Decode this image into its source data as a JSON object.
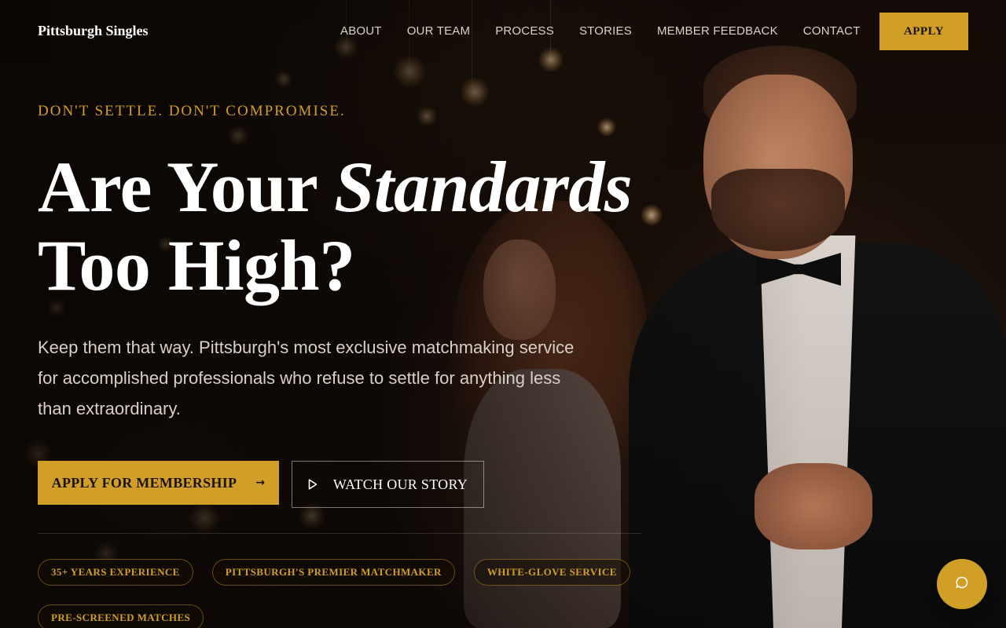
{
  "brand": {
    "name": "Pittsburgh Singles",
    "accent_color": "#d19f27"
  },
  "nav": {
    "items": [
      {
        "label": "ABOUT"
      },
      {
        "label": "OUR TEAM"
      },
      {
        "label": "PROCESS"
      },
      {
        "label": "STORIES"
      },
      {
        "label": "MEMBER FEEDBACK"
      },
      {
        "label": "CONTACT"
      }
    ],
    "apply_label": "APPLY"
  },
  "hero": {
    "eyebrow": "DON'T SETTLE. DON'T COMPROMISE.",
    "headline_part1": "Are Your ",
    "headline_emphasis": "Standards",
    "headline_part2": "Too High?",
    "lead": "Keep them that way. Pittsburgh's most exclusive matchmaking service for accomplished professionals who refuse to settle for anything less than extraordinary.",
    "primary_cta": {
      "label": "APPLY FOR MEMBERSHIP",
      "icon": "arrow-right-icon"
    },
    "secondary_cta": {
      "label": "WATCH OUR STORY",
      "icon": "play-icon"
    },
    "badges": [
      {
        "label": "35+ YEARS EXPERIENCE"
      },
      {
        "label": "PITTSBURGH'S PREMIER MATCHMAKER"
      },
      {
        "label": "WHITE-GLOVE SERVICE"
      },
      {
        "label": "PRE-SCREENED MATCHES"
      }
    ]
  },
  "chat": {
    "icon": "chat-bubble-icon"
  }
}
